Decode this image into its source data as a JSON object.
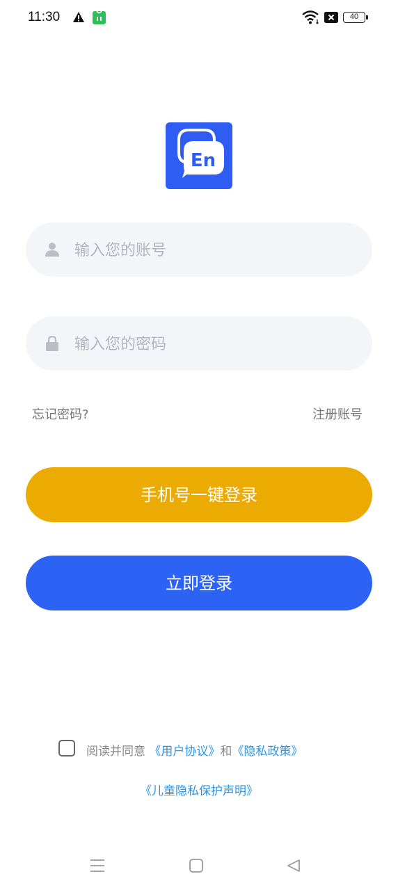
{
  "status_bar": {
    "time": "11:30",
    "battery": "40",
    "icons": [
      "warning-icon",
      "app-notification-icon",
      "wifi-icon",
      "sim-icon",
      "battery-icon"
    ]
  },
  "logo": {
    "text": "En",
    "color": "#2f5cf2"
  },
  "form": {
    "account_placeholder": "输入您的账号",
    "password_placeholder": "输入您的密码",
    "account_value": "",
    "password_value": ""
  },
  "links": {
    "forgot_password": "忘记密码?",
    "register": "注册账号"
  },
  "buttons": {
    "phone_login": "手机号一键登录",
    "login_now": "立即登录"
  },
  "agreement": {
    "checked": false,
    "prefix": "阅读并同意",
    "user_agreement": "《用户协议》",
    "and": "和",
    "privacy_policy": "《隐私政策》",
    "child_privacy": "《儿童隐私保护声明》"
  },
  "colors": {
    "primary_blue": "#2d63f5",
    "orange": "#ecab03",
    "link_blue": "#2c95e8",
    "input_bg": "#f4f5f9"
  },
  "nav_bar": {
    "icons": [
      "menu-icon",
      "home-icon",
      "back-icon"
    ]
  }
}
